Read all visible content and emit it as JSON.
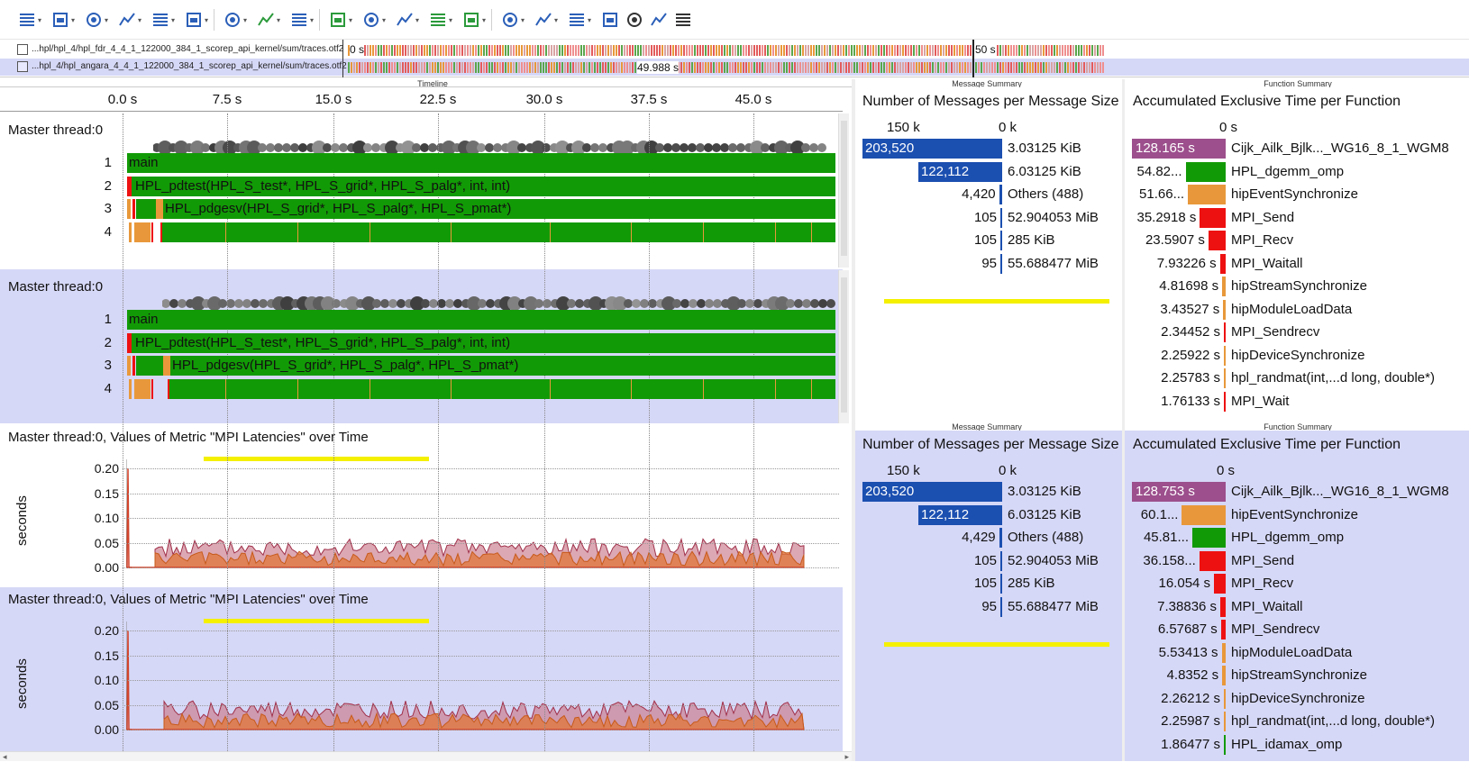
{
  "toolbar": {
    "icons": [
      "timeline-icon",
      "process-timeline-icon",
      "counter-timeline-icon",
      "function-legend-icon",
      "performance-radar-icon",
      "metric-timeline-icon",
      "call-tree-icon",
      "function-summary-icon",
      "message-summary-icon",
      "communication-matrix-icon",
      "io-summary-icon",
      "message-icon",
      "zoom-icon",
      "filter-icon",
      "call-stack-icon",
      "grid-icon",
      "hierarchy-icon",
      "tree-icon",
      "list-icon",
      "pin-icon",
      "notes-icon"
    ]
  },
  "traces": [
    {
      "path": "...hpl/hpl_4/hpl_fdr_4_4_1_122000_384_1_scorep_api_kernel/sum/traces.otf2",
      "start": "0 s",
      "end": "50 s"
    },
    {
      "path": "...hpl_4/hpl_angara_4_4_1_122000_384_1_scorep_api_kernel/sum/traces.otf2",
      "end": "49.988 s"
    }
  ],
  "panels": {
    "timeline_header": "Timeline",
    "message_summary_header": "Message Summary",
    "function_summary_header": "Function Summary"
  },
  "timeline": {
    "ticks": [
      "0.0 s",
      "7.5 s",
      "15.0 s",
      "22.5 s",
      "30.0 s",
      "37.5 s",
      "45.0 s"
    ],
    "groups": [
      {
        "title": "Master thread:0",
        "rows": [
          {
            "num": "1",
            "label": "main"
          },
          {
            "num": "2",
            "label": "HPL_pdtest(HPL_S_test*, HPL_S_grid*, HPL_S_palg*, int, int)"
          },
          {
            "num": "3",
            "label": "HPL_pdgesv(HPL_S_grid*, HPL_S_palg*, HPL_S_pmat*)"
          },
          {
            "num": "4",
            "label": ""
          }
        ]
      },
      {
        "title": "Master thread:0",
        "rows": [
          {
            "num": "1",
            "label": "main"
          },
          {
            "num": "2",
            "label": "HPL_pdtest(HPL_S_test*, HPL_S_grid*, HPL_S_palg*, int, int)"
          },
          {
            "num": "3",
            "label": "HPL_pdgesv(HPL_S_grid*, HPL_S_palg*, HPL_S_pmat*)"
          },
          {
            "num": "4",
            "label": ""
          }
        ]
      }
    ]
  },
  "metric_charts": [
    {
      "title": "Master thread:0, Values of Metric \"MPI Latencies\" over Time",
      "ylabel": "seconds",
      "yticks": [
        "0.20",
        "0.15",
        "0.10",
        "0.05",
        "0.00"
      ]
    },
    {
      "title": "Master thread:0, Values of Metric \"MPI Latencies\" over Time",
      "ylabel": "seconds",
      "yticks": [
        "0.20",
        "0.15",
        "0.10",
        "0.05",
        "0.00"
      ]
    }
  ],
  "message_summaries": [
    {
      "title": "Number of Messages per Message Size",
      "axis": [
        "150 k",
        "0 k"
      ],
      "rows": [
        {
          "count": "203,520",
          "size": "3.03125 KiB",
          "value": 203520,
          "color": "#1b4fb0"
        },
        {
          "count": "122,112",
          "size": "6.03125 KiB",
          "value": 122112,
          "color": "#1b4fb0"
        },
        {
          "count": "4,420",
          "size": "Others (488)",
          "value": 4420,
          "color": "#1b4fb0"
        },
        {
          "count": "105",
          "size": "52.904053 MiB",
          "value": 105,
          "color": "#1b4fb0"
        },
        {
          "count": "105",
          "size": "285 KiB",
          "value": 105,
          "color": "#1b4fb0"
        },
        {
          "count": "95",
          "size": "55.688477 MiB",
          "value": 95,
          "color": "#1b4fb0"
        }
      ]
    },
    {
      "title": "Number of Messages per Message Size",
      "axis": [
        "150 k",
        "0 k"
      ],
      "rows": [
        {
          "count": "203,520",
          "size": "3.03125 KiB",
          "value": 203520,
          "color": "#1b4fb0"
        },
        {
          "count": "122,112",
          "size": "6.03125 KiB",
          "value": 122112,
          "color": "#1b4fb0"
        },
        {
          "count": "4,429",
          "size": "Others (488)",
          "value": 4429,
          "color": "#1b4fb0"
        },
        {
          "count": "105",
          "size": "52.904053 MiB",
          "value": 105,
          "color": "#1b4fb0"
        },
        {
          "count": "105",
          "size": "285 KiB",
          "value": 105,
          "color": "#1b4fb0"
        },
        {
          "count": "95",
          "size": "55.688477 MiB",
          "value": 95,
          "color": "#1b4fb0"
        }
      ]
    }
  ],
  "function_summaries": [
    {
      "title": "Accumulated Exclusive Time per Function",
      "axis": "0 s",
      "rows": [
        {
          "time": "128.165 s",
          "name": "Cijk_Ailk_Bjlk..._WG16_8_1_WGM8",
          "value": 128.165,
          "color": "#9c4f8c"
        },
        {
          "time": "54.82...",
          "name": "HPL_dgemm_omp",
          "value": 54.82,
          "color": "#129a06"
        },
        {
          "time": "51.66...",
          "name": "hipEventSynchronize",
          "value": 51.66,
          "color": "#e8983a"
        },
        {
          "time": "35.2918 s",
          "name": "MPI_Send",
          "value": 35.2918,
          "color": "#ee1111"
        },
        {
          "time": "23.5907 s",
          "name": "MPI_Recv",
          "value": 23.5907,
          "color": "#ee1111"
        },
        {
          "time": "7.93226 s",
          "name": "MPI_Waitall",
          "value": 7.93226,
          "color": "#ee1111"
        },
        {
          "time": "4.81698 s",
          "name": "hipStreamSynchronize",
          "value": 4.81698,
          "color": "#e8983a"
        },
        {
          "time": "3.43527 s",
          "name": "hipModuleLoadData",
          "value": 3.43527,
          "color": "#e8983a"
        },
        {
          "time": "2.34452 s",
          "name": "MPI_Sendrecv",
          "value": 2.34452,
          "color": "#ee1111"
        },
        {
          "time": "2.25922 s",
          "name": "hipDeviceSynchronize",
          "value": 2.25922,
          "color": "#e8983a"
        },
        {
          "time": "2.25783 s",
          "name": "hpl_randmat(int,...d long, double*)",
          "value": 2.25783,
          "color": "#e8983a"
        },
        {
          "time": "1.76133 s",
          "name": "MPI_Wait",
          "value": 1.76133,
          "color": "#ee1111"
        }
      ]
    },
    {
      "title": "Accumulated Exclusive Time per Function",
      "axis": "0 s",
      "rows": [
        {
          "time": "128.753 s",
          "name": "Cijk_Ailk_Bjlk..._WG16_8_1_WGM8",
          "value": 128.753,
          "color": "#9c4f8c"
        },
        {
          "time": "60.1...",
          "name": "hipEventSynchronize",
          "value": 60.1,
          "color": "#e8983a"
        },
        {
          "time": "45.81...",
          "name": "HPL_dgemm_omp",
          "value": 45.81,
          "color": "#129a06"
        },
        {
          "time": "36.158...",
          "name": "MPI_Send",
          "value": 36.158,
          "color": "#ee1111"
        },
        {
          "time": "16.054 s",
          "name": "MPI_Recv",
          "value": 16.054,
          "color": "#ee1111"
        },
        {
          "time": "7.38836 s",
          "name": "MPI_Waitall",
          "value": 7.38836,
          "color": "#ee1111"
        },
        {
          "time": "6.57687 s",
          "name": "MPI_Sendrecv",
          "value": 6.57687,
          "color": "#ee1111"
        },
        {
          "time": "5.53413 s",
          "name": "hipModuleLoadData",
          "value": 5.53413,
          "color": "#e8983a"
        },
        {
          "time": "4.8352 s",
          "name": "hipStreamSynchronize",
          "value": 4.8352,
          "color": "#e8983a"
        },
        {
          "time": "2.26212 s",
          "name": "hipDeviceSynchronize",
          "value": 2.26212,
          "color": "#e8983a"
        },
        {
          "time": "2.25987 s",
          "name": "hpl_randmat(int,...d long, double*)",
          "value": 2.25987,
          "color": "#e8983a"
        },
        {
          "time": "1.86477 s",
          "name": "HPL_idamax_omp",
          "value": 1.86477,
          "color": "#129a06"
        }
      ]
    }
  ],
  "colors": {
    "selected_bg": "#d6d8f7",
    "main_green": "#129a06",
    "mpi_red": "#ee1111",
    "hip_orange": "#e8983a",
    "kernel_purple": "#9c4f8c",
    "msg_blue": "#1b4fb0",
    "highlight_yellow": "#f4f000"
  }
}
